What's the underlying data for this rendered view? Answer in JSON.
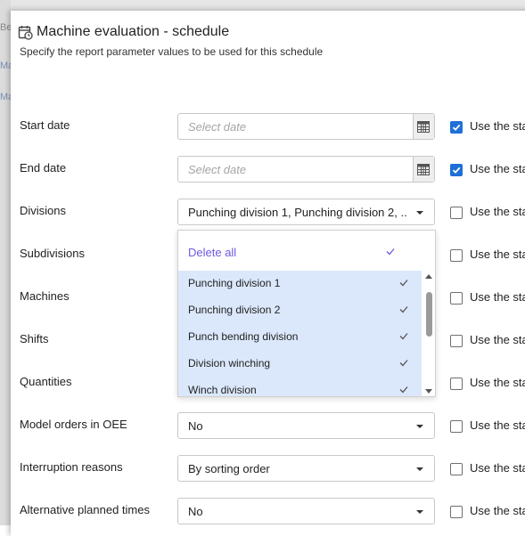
{
  "background": {
    "partial_labels": [
      "Be",
      "Ma",
      "Ma"
    ]
  },
  "dialog": {
    "title": "Machine evaluation - schedule",
    "subtitle": "Specify the report parameter values to be used for this schedule",
    "icon": "calendar-clock-icon"
  },
  "rows": [
    {
      "label": "Start date",
      "value": "",
      "placeholder": "Select date",
      "type": "date",
      "checked": true,
      "check_label": "Use the sta"
    },
    {
      "label": "End date",
      "value": "",
      "placeholder": "Select date",
      "type": "date",
      "checked": true,
      "check_label": "Use the sta"
    },
    {
      "label": "Divisions",
      "value": "Punching division 1, Punching division 2, ...",
      "type": "select",
      "checked": false,
      "check_label": "Use the sta"
    },
    {
      "label": "Subdivisions",
      "checked": false,
      "check_label": "Use the sta"
    },
    {
      "label": "Machines",
      "checked": false,
      "check_label": "Use the sta"
    },
    {
      "label": "Shifts",
      "checked": false,
      "check_label": "Use the sta"
    },
    {
      "label": "Quantities",
      "checked": false,
      "check_label": "Use the sta"
    },
    {
      "label": "Model orders in OEE",
      "value": "No",
      "type": "select",
      "checked": false,
      "check_label": "Use the sta"
    },
    {
      "label": "Interruption reasons",
      "value": "By sorting order",
      "type": "select",
      "checked": false,
      "check_label": "Use the sta"
    },
    {
      "label": "Alternative planned times",
      "value": "No",
      "type": "select",
      "checked": false,
      "check_label": "Use the sta"
    }
  ],
  "dropdown": {
    "delete_all_label": "Delete all",
    "items": [
      {
        "label": "Punching division 1",
        "selected": true
      },
      {
        "label": "Punching division 2",
        "selected": true
      },
      {
        "label": "Punch bending division",
        "selected": true
      },
      {
        "label": "Division winching",
        "selected": true
      },
      {
        "label": "Winch division",
        "selected": true
      }
    ]
  },
  "colors": {
    "accent": "#1f6fd8",
    "delete_all": "#6d5ae0",
    "selected_item_bg": "#dbe8fb"
  }
}
